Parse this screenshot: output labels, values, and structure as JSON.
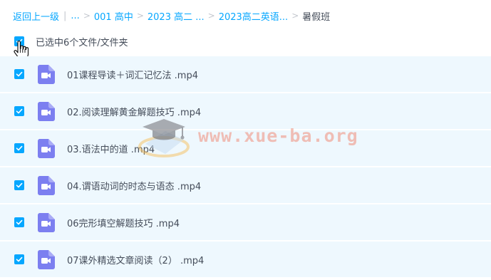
{
  "breadcrumb": {
    "back_label": "返回上一级",
    "ellipsis": "...",
    "items": [
      "001 高中",
      "2023 高二 ...",
      "2023高二英语..."
    ],
    "current": "暑假班"
  },
  "selection": {
    "label": "已选中6个文件/文件夹",
    "checked": true
  },
  "files": [
    {
      "name": "01课程导读＋词汇记忆法 .mp4",
      "icon": "video-file-icon",
      "checked": true
    },
    {
      "name": "02.阅读理解黄金解题技巧 .mp4",
      "icon": "video-file-icon",
      "checked": true
    },
    {
      "name": "03.语法中的道 .mp4",
      "icon": "video-file-icon",
      "checked": true
    },
    {
      "name": "04.谓语动词的时态与语态 .mp4",
      "icon": "video-file-icon",
      "checked": true
    },
    {
      "name": "06完形填空解题技巧 .mp4",
      "icon": "video-file-icon",
      "checked": true
    },
    {
      "name": "07课外精选文章阅读（2） .mp4",
      "icon": "video-file-icon",
      "checked": true
    }
  ],
  "watermark": {
    "text": "www.xue-ba.org"
  },
  "colors": {
    "accent": "#06a7ff",
    "row_bg": "#eef8fe",
    "text": "#454d5a",
    "video_icon": "#7c7ff0"
  }
}
